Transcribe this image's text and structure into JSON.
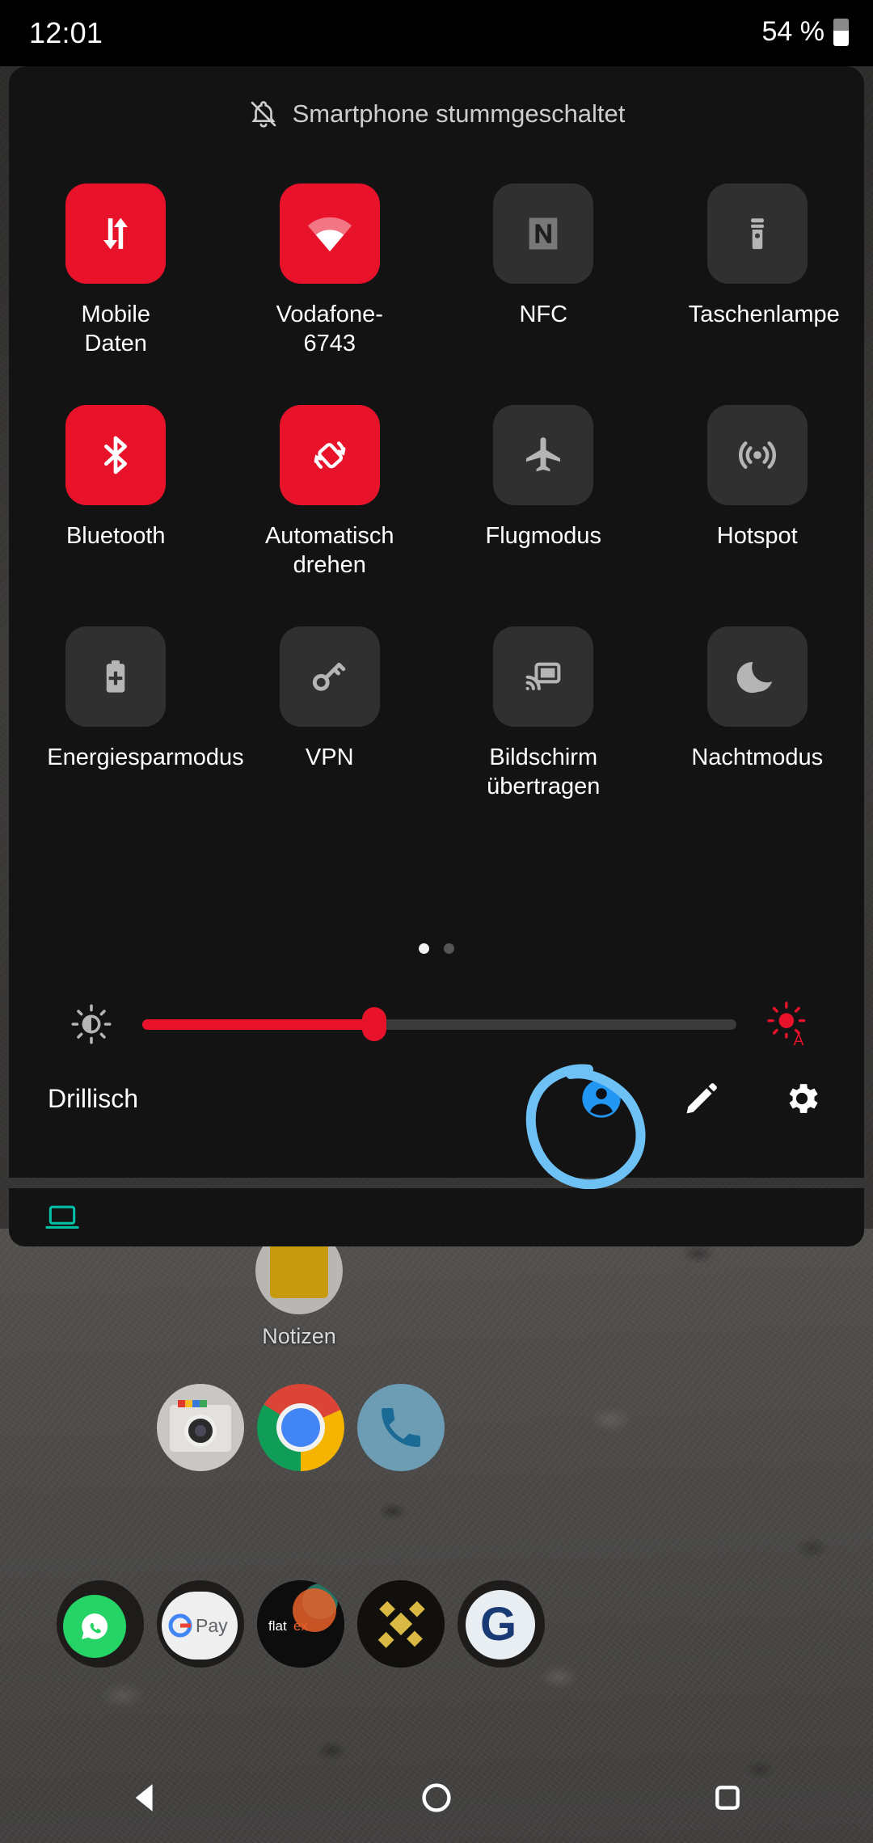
{
  "status_bar": {
    "time": "12:01",
    "battery_percent": "54 %",
    "battery_icon": "battery-icon"
  },
  "quick_settings": {
    "header_text": "Smartphone stummgeschaltet",
    "header_icon": "bell-off-icon",
    "tiles": [
      {
        "label": "Mobile Daten",
        "icon": "mobile-data-icon",
        "state": "on"
      },
      {
        "label": "Vodafone-6743",
        "icon": "wifi-icon",
        "state": "on"
      },
      {
        "label": "NFC",
        "icon": "nfc-icon",
        "state": "off"
      },
      {
        "label": "Taschenlampe",
        "icon": "flashlight-icon",
        "state": "off"
      },
      {
        "label": "Bluetooth",
        "icon": "bluetooth-icon",
        "state": "on"
      },
      {
        "label": "Automatisch drehen",
        "icon": "auto-rotate-icon",
        "state": "on"
      },
      {
        "label": "Flugmodus",
        "icon": "airplane-icon",
        "state": "off"
      },
      {
        "label": "Hotspot",
        "icon": "hotspot-icon",
        "state": "off"
      },
      {
        "label": "Energiesparmodus",
        "icon": "battery-saver-icon",
        "state": "off"
      },
      {
        "label": "VPN",
        "icon": "key-icon",
        "state": "off"
      },
      {
        "label": "Bildschirm übertragen",
        "icon": "cast-icon",
        "state": "off"
      },
      {
        "label": "Nachtmodus",
        "icon": "moon-icon",
        "state": "off"
      }
    ],
    "pages": {
      "count": 2,
      "active_index": 0
    },
    "brightness": {
      "value_percent": 39,
      "low_icon": "brightness-low-icon",
      "auto_icon": "brightness-auto-icon",
      "track_color": "#3a3a3a",
      "fill_color": "#e8132b"
    },
    "footer": {
      "carrier": "Drillisch",
      "user_icon": "user-avatar-icon",
      "edit_icon": "pencil-edit-icon",
      "settings_icon": "gear-icon"
    },
    "accent_on_color": "#e8132b",
    "tile_off_color": "#303030"
  },
  "annotation": {
    "shape": "hand-drawn-circle",
    "color": "#6ec1f5",
    "target": "user-avatar-icon"
  },
  "notification_shelf": {
    "icon": "laptop-icon",
    "icon_color": "#00bfa5"
  },
  "home_screen": {
    "apps": [
      {
        "label": "Notizen",
        "icon": "notes-icon"
      },
      {
        "label": "",
        "icon": "camera-icon"
      },
      {
        "label": "",
        "icon": "chrome-icon"
      },
      {
        "label": "",
        "icon": "phone-icon"
      }
    ],
    "dock": [
      {
        "label": "WhatsApp",
        "icon": "whatsapp-icon"
      },
      {
        "label": "G Pay",
        "icon": "google-pay-icon"
      },
      {
        "label": "flatex",
        "icon": "flatex-icon"
      },
      {
        "label": "Binance",
        "icon": "binance-icon"
      },
      {
        "label": "G",
        "icon": "gls-icon"
      }
    ]
  },
  "nav_bar": {
    "back": "back-icon",
    "home": "home-icon",
    "recents": "recents-icon"
  }
}
